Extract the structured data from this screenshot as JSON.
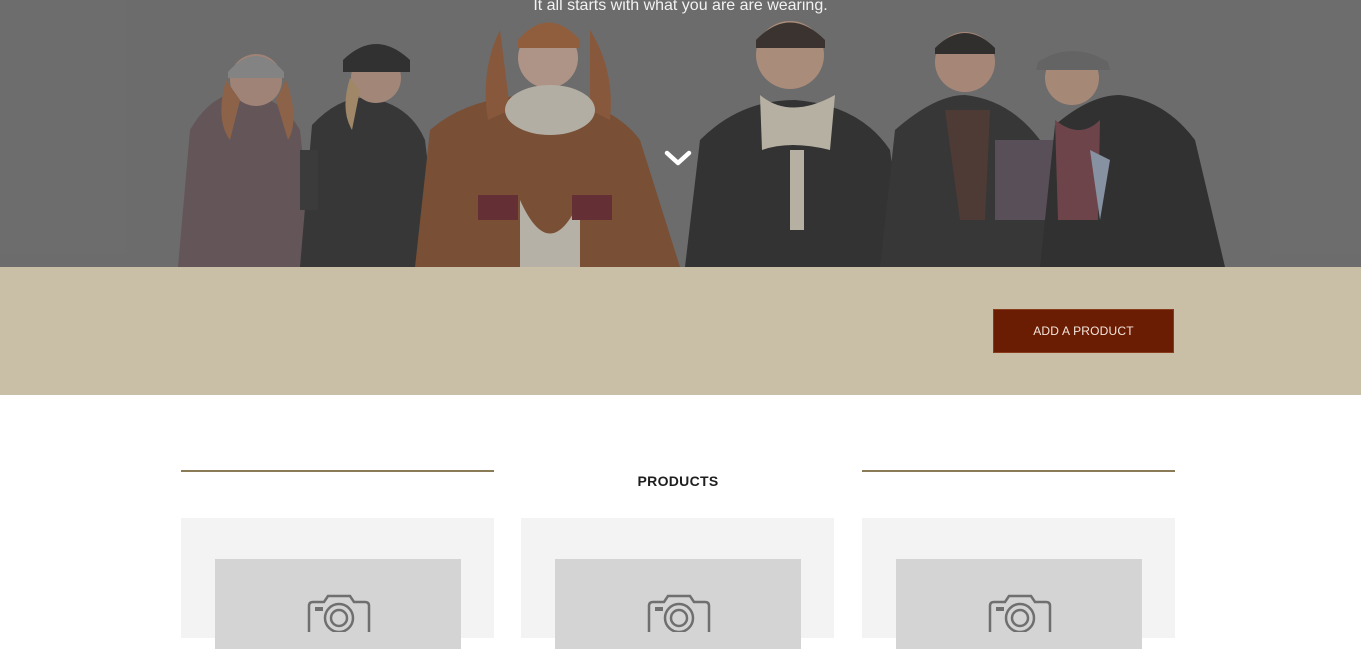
{
  "hero": {
    "tagline": "It all starts with what you are are wearing.",
    "scroll_icon": "chevron-down-icon"
  },
  "actions": {
    "add_product_label": "ADD A PRODUCT"
  },
  "products": {
    "title": "PRODUCTS",
    "cards": [
      {
        "image_icon": "camera-icon"
      },
      {
        "image_icon": "camera-icon"
      },
      {
        "image_icon": "camera-icon"
      }
    ]
  },
  "colors": {
    "accent": "#6b1d04",
    "band": "#c9bfa6",
    "rule": "#8a7a55",
    "card_bg": "#f3f3f4",
    "placeholder_bg": "#d4d4d5"
  }
}
